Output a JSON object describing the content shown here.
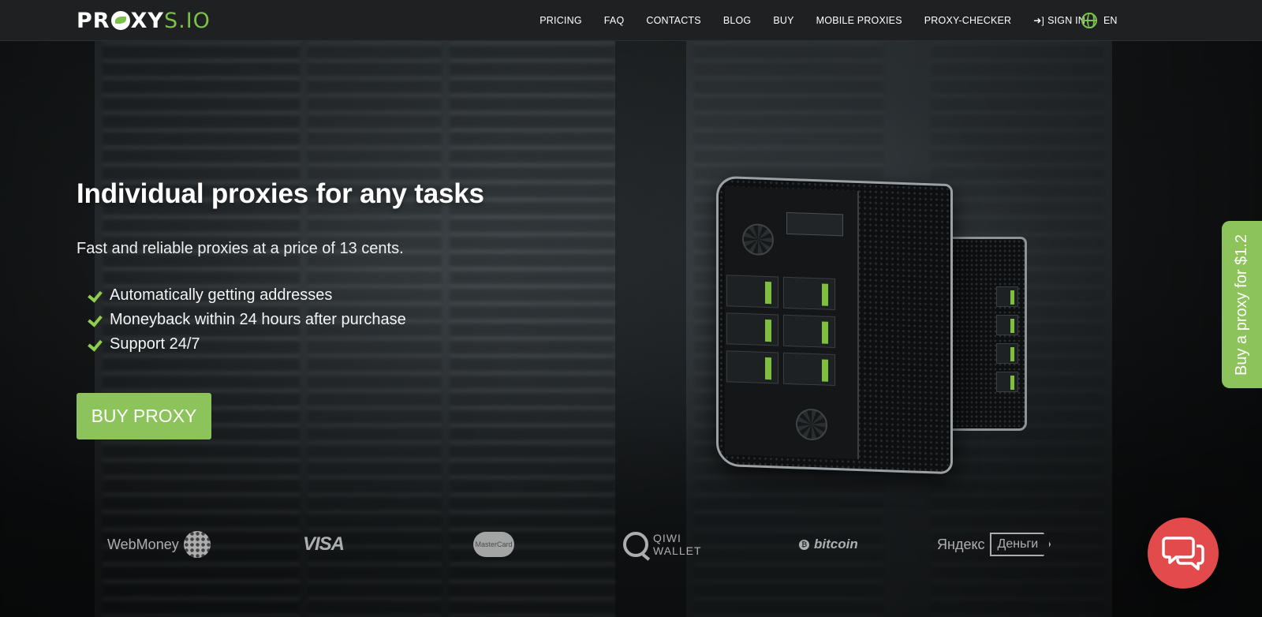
{
  "brand": {
    "logo_prefix": "PR",
    "logo_mid": "XY",
    "logo_suffix": "S.IO",
    "accent": "#8cc35a"
  },
  "nav": {
    "items": [
      {
        "label": "PRICING"
      },
      {
        "label": "FAQ"
      },
      {
        "label": "CONTACTS"
      },
      {
        "label": "BLOG"
      },
      {
        "label": "BUY"
      },
      {
        "label": "MOBILE PROXIES"
      },
      {
        "label": "PROXY-CHECKER"
      },
      {
        "label": "SIGN IN",
        "icon": "sign-in-icon"
      }
    ],
    "language": {
      "label": "EN",
      "icon": "globe-icon"
    }
  },
  "hero": {
    "headline": "Individual proxies for any tasks",
    "subline": "Fast and reliable proxies at a price of 13 cents.",
    "features": [
      "Automatically getting addresses",
      "Moneyback within 24 hours after purchase",
      "Support 24/7"
    ],
    "cta_label": "BUY PROXY"
  },
  "payments": {
    "webmoney": "WebMoney",
    "visa": "VISA",
    "mastercard": "MasterCard",
    "qiwi_line1": "QIWI",
    "qiwi_line2": "WALLET",
    "bitcoin": "bitcoin",
    "bitcoin_symbol": "₿",
    "yandex": "Яндекс",
    "yandex_money": "Деньги"
  },
  "side_tab": {
    "label": "Buy a proxy for $1.2"
  },
  "chat": {
    "icon": "chat-bubbles-icon",
    "color": "#e34a4b"
  }
}
